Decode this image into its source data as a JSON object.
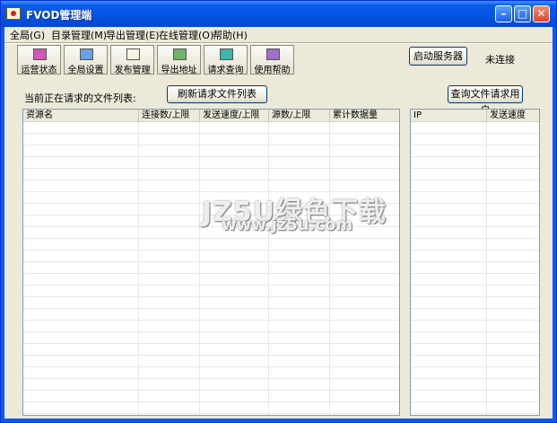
{
  "window": {
    "title": "FVOD管理端",
    "minimize": "–",
    "maximize": "□",
    "close": "✕"
  },
  "menu": [
    "全局(G)",
    "目录管理(M)",
    "导出管理(E)",
    "在线管理(O)",
    "帮助(H)"
  ],
  "toolbar": [
    {
      "label": "运营状态",
      "icon": "monitor-icon"
    },
    {
      "label": "全局设置",
      "icon": "settings-icon"
    },
    {
      "label": "发布管理",
      "icon": "publish-icon"
    },
    {
      "label": "导出地址",
      "icon": "export-icon"
    },
    {
      "label": "请求查询",
      "icon": "query-icon"
    },
    {
      "label": "使用帮助",
      "icon": "help-icon"
    }
  ],
  "server": {
    "start_label": "启动服务器",
    "status": "未连接"
  },
  "files": {
    "section_label": "当前正在请求的文件列表:",
    "refresh_label": "刷新请求文件列表",
    "columns": [
      "资源名",
      "连接数/上限",
      "发送速度/上限",
      "源数/上限",
      "累计数据量"
    ]
  },
  "users": {
    "query_label": "查询文件请求用户",
    "columns": [
      "IP",
      "发送速度"
    ]
  },
  "watermark": {
    "line1": "JZ5U绿色下载",
    "line2": "www.jz5u.com"
  }
}
